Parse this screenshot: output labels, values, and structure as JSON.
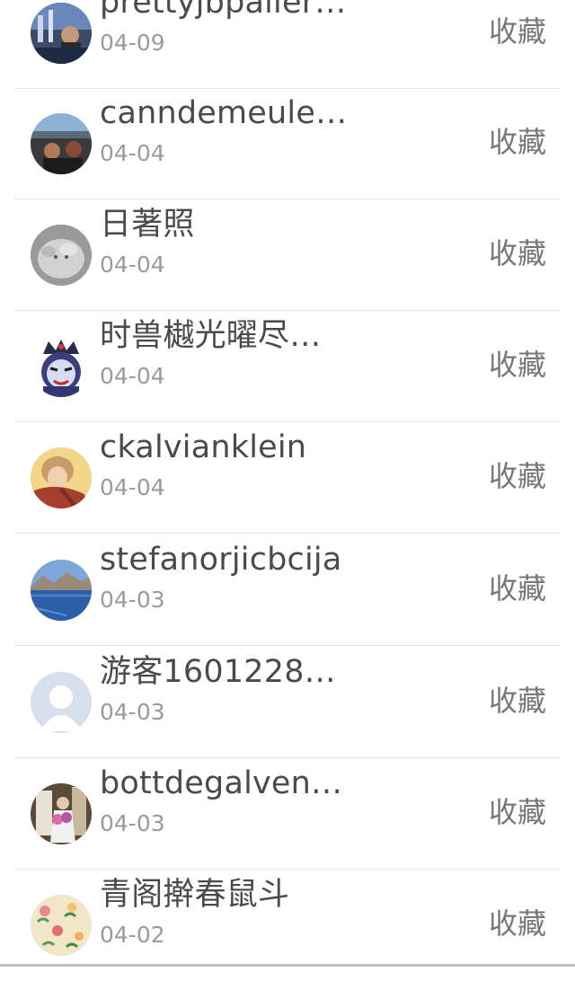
{
  "action_label": "收藏",
  "items": [
    {
      "name": "prettyjbpaller…",
      "date": "04-09",
      "avatar": "city-night-photo"
    },
    {
      "name": "canndemeule…",
      "date": "04-04",
      "avatar": "car-interior-photo"
    },
    {
      "name": "日著照",
      "date": "04-04",
      "avatar": "cat-photo"
    },
    {
      "name": "时兽樾光曜尽…",
      "date": "04-04",
      "avatar": "opera-mask-cartoon"
    },
    {
      "name": "ckalvianklein",
      "date": "04-04",
      "avatar": "person-scarf-photo"
    },
    {
      "name": "stefanorjicbcija",
      "date": "04-03",
      "avatar": "lake-landscape-photo"
    },
    {
      "name": "游客1601228…",
      "date": "04-03",
      "avatar": "default-person-placeholder"
    },
    {
      "name": "bottdegalven…",
      "date": "04-03",
      "avatar": "flowers-girl-photo"
    },
    {
      "name": "青阁擀春鼠斗",
      "date": "04-02",
      "avatar": "floral-pattern"
    }
  ]
}
